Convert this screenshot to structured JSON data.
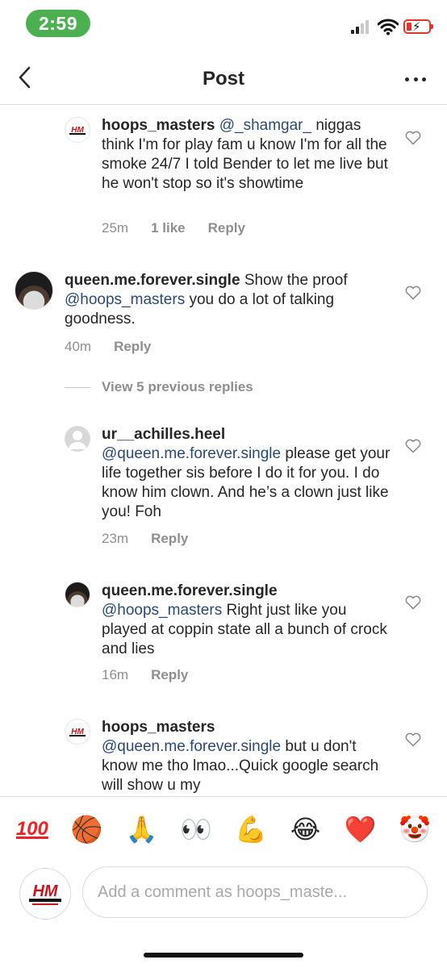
{
  "status_bar": {
    "time": "2:59"
  },
  "header": {
    "title": "Post"
  },
  "comments": [
    {
      "username": "hoops_masters",
      "mention": "@_shamgar_",
      "text": "niggas think I'm for play fam u know I'm for all the smoke 24/7 I told Bender to let me live but he won't stop so it's showtime",
      "time": "25m",
      "likes": "1 like",
      "reply": "Reply"
    },
    {
      "username": "queen.me.forever.single",
      "text_before": "Show the proof",
      "mention": "@hoops_masters",
      "text": "you do a lot of talking goodness.",
      "time": "40m",
      "reply": "Reply"
    },
    {
      "username": "ur__achilles.heel",
      "mention": "@queen.me.forever.single",
      "text": "please get your life together sis before I do it for you. I do know him clown. And he’s a clown just like you! Foh",
      "time": "23m",
      "reply": "Reply"
    },
    {
      "username": "queen.me.forever.single",
      "mention": "@hoops_masters",
      "text": "Right just like you played at coppin state all a bunch of crock and lies",
      "time": "16m",
      "reply": "Reply"
    },
    {
      "username": "hoops_masters",
      "mention": "@queen.me.forever.single",
      "text": "but u don't know me tho lmao...Quick google search will show u my"
    }
  ],
  "view_replies": "View 5 previous replies",
  "emoji_bar": [
    "💯",
    "🏀",
    "🙏",
    "👀",
    "💪",
    "😂",
    "❤️",
    "🤡"
  ],
  "compose": {
    "placeholder": "Add a comment as hoops_maste..."
  },
  "colors": {
    "time_pill": "#4cb050",
    "mention": "#2a4a74",
    "meta": "#8e8e8e",
    "battery": "#e0352b"
  }
}
